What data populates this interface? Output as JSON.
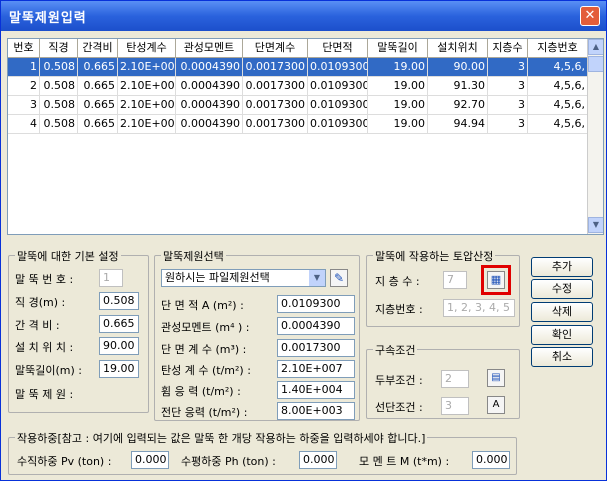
{
  "window": {
    "title": "말뚝제원입력",
    "close": "✕"
  },
  "grid": {
    "headers": [
      "번호",
      "직경",
      "간격비",
      "탄성계수",
      "관성모멘트",
      "단면계수",
      "단면적",
      "말뚝길이",
      "설치위치",
      "지층수",
      "지층번호"
    ],
    "rows": [
      [
        "1",
        "0.508",
        "0.665",
        "2.10E+007",
        "0.0004390",
        "0.0017300",
        "0.0109300",
        "19.00",
        "90.00",
        "3",
        "4,5,6,"
      ],
      [
        "2",
        "0.508",
        "0.665",
        "2.10E+007",
        "0.0004390",
        "0.0017300",
        "0.0109300",
        "19.00",
        "91.30",
        "3",
        "4,5,6,"
      ],
      [
        "3",
        "0.508",
        "0.665",
        "2.10E+007",
        "0.0004390",
        "0.0017300",
        "0.0109300",
        "19.00",
        "92.70",
        "3",
        "4,5,6,"
      ],
      [
        "4",
        "0.508",
        "0.665",
        "2.10E+007",
        "0.0004390",
        "0.0017300",
        "0.0109300",
        "19.00",
        "94.94",
        "3",
        "4,5,6,"
      ]
    ],
    "selected_row": 0,
    "scroll_up": "▲",
    "scroll_down": "▼"
  },
  "basic": {
    "legend": "말뚝에 대한 기본 설정",
    "pile_no_label": "말 뚝 번 호 :",
    "pile_no": "1",
    "diameter_label": "직      경(m) :",
    "diameter": "0.508",
    "spacing_label": "간   격    비 :",
    "spacing": "0.665",
    "position_label": "설 치 위 치 :",
    "position": "90.00",
    "length_label": "말뚝길이(m) :",
    "length": "19.00",
    "spec_label": "말 뚝 제 원 :"
  },
  "spec": {
    "legend": "말뚝제원선택",
    "select_value": "원하시는 파일제원선택",
    "area_label": "단 면 적  A (m²) :",
    "area": "0.0109300",
    "inertia_label": "관성모멘트  (m⁴ ) :",
    "inertia": "0.0004390",
    "modulus_label": "단 면 계 수 (m³) :",
    "modulus": "0.0017300",
    "elastic_label": "탄성 계 수 (t/m²) :",
    "elastic": "2.10E+007",
    "bending_label": "휨  응 력 (t/m²) :",
    "bending": "1.40E+004",
    "shear_label": "전단 응력 (t/m²) :",
    "shear": "8.00E+003"
  },
  "soil": {
    "legend": "말뚝에 작용하는 토압산정",
    "layers_label": "지 층 수 :",
    "layers": "7",
    "layer_no_label": "지층번호 :",
    "layer_no": "1, 2, 3, 4, 5"
  },
  "restraint": {
    "legend": "구속조건",
    "head_label": "두부조건 :",
    "head": "2",
    "tip_label": "선단조건 :",
    "tip": "3",
    "tip_btn": "A"
  },
  "buttons": {
    "add": "추가",
    "edit": "수정",
    "delete": "삭제",
    "ok": "확인",
    "cancel": "취소"
  },
  "load": {
    "legend": "작용하중[참고 : 여기에 입력되는 값은 말뚝 한 개당 작용하는 하중을 입력하세야 합니다.]",
    "pv_label": "수직하중 Pv (ton) :",
    "pv": "0.000",
    "ph_label": "수평하중 Ph (ton) :",
    "ph": "0.000",
    "m_label": "모 멘 트  M (t*m) :",
    "m": "0.000"
  },
  "colors": {
    "selected_row": "#316ac5",
    "highlight_box": "#e00000",
    "title_bar": "#2a62dd"
  }
}
